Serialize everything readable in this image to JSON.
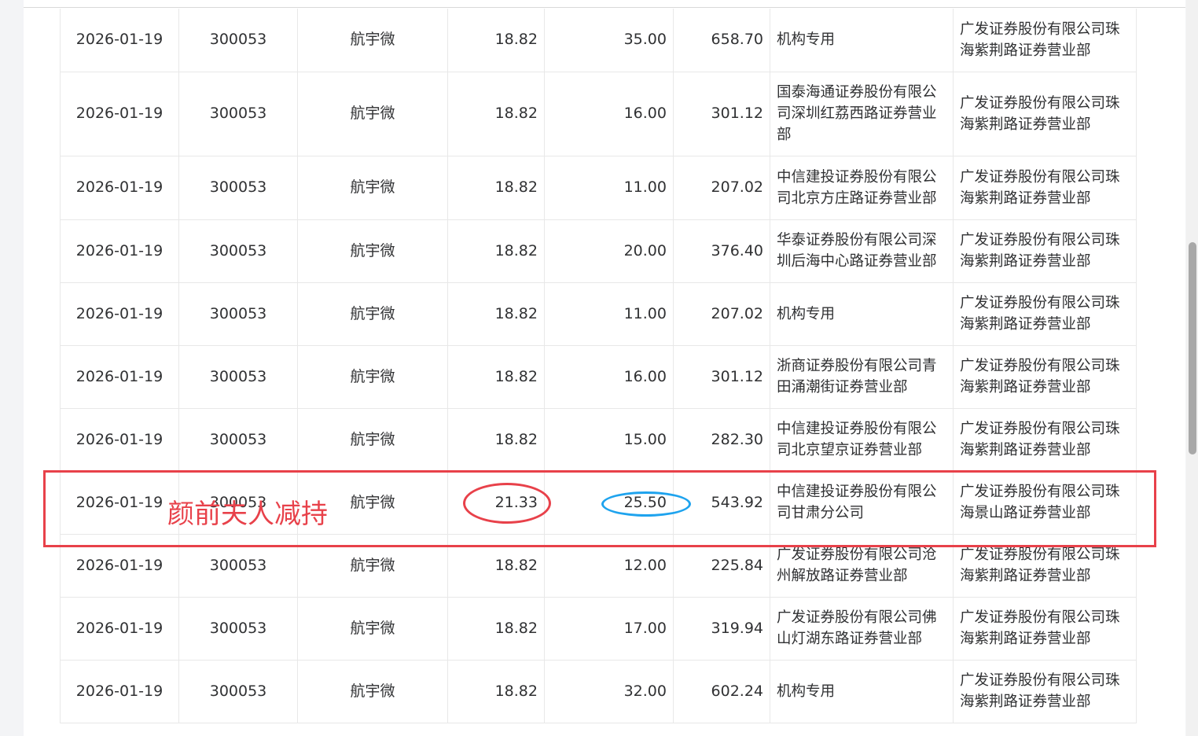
{
  "table": {
    "rows": [
      {
        "date": "2026-01-19",
        "code": "300053",
        "name": "航宇微",
        "price": "18.82",
        "volume": "35.00",
        "amount": "658.70",
        "buyer": "机构专用",
        "seller": "广发证券股份有限公司珠海紫荆路证券营业部"
      },
      {
        "date": "2026-01-19",
        "code": "300053",
        "name": "航宇微",
        "price": "18.82",
        "volume": "16.00",
        "amount": "301.12",
        "buyer": "国泰海通证券股份有限公司深圳红荔西路证券营业部",
        "seller": "广发证券股份有限公司珠海紫荆路证券营业部"
      },
      {
        "date": "2026-01-19",
        "code": "300053",
        "name": "航宇微",
        "price": "18.82",
        "volume": "11.00",
        "amount": "207.02",
        "buyer": "中信建投证券股份有限公司北京方庄路证券营业部",
        "seller": "广发证券股份有限公司珠海紫荆路证券营业部"
      },
      {
        "date": "2026-01-19",
        "code": "300053",
        "name": "航宇微",
        "price": "18.82",
        "volume": "20.00",
        "amount": "376.40",
        "buyer": "华泰证券股份有限公司深圳后海中心路证券营业部",
        "seller": "广发证券股份有限公司珠海紫荆路证券营业部"
      },
      {
        "date": "2026-01-19",
        "code": "300053",
        "name": "航宇微",
        "price": "18.82",
        "volume": "11.00",
        "amount": "207.02",
        "buyer": "机构专用",
        "seller": "广发证券股份有限公司珠海紫荆路证券营业部"
      },
      {
        "date": "2026-01-19",
        "code": "300053",
        "name": "航宇微",
        "price": "18.82",
        "volume": "16.00",
        "amount": "301.12",
        "buyer": "浙商证券股份有限公司青田涌潮街证券营业部",
        "seller": "广发证券股份有限公司珠海紫荆路证券营业部"
      },
      {
        "date": "2026-01-19",
        "code": "300053",
        "name": "航宇微",
        "price": "18.82",
        "volume": "15.00",
        "amount": "282.30",
        "buyer": "中信建投证券股份有限公司北京望京证券营业部",
        "seller": "广发证券股份有限公司珠海紫荆路证券营业部"
      },
      {
        "date": "2026-01-19",
        "code": "300053",
        "name": "航宇微",
        "price": "21.33",
        "volume": "25.50",
        "amount": "543.92",
        "buyer": "中信建投证券股份有限公司甘肃分公司",
        "seller": "广发证券股份有限公司珠海景山路证券营业部"
      },
      {
        "date": "2026-01-19",
        "code": "300053",
        "name": "航宇微",
        "price": "18.82",
        "volume": "12.00",
        "amount": "225.84",
        "buyer": "广发证券股份有限公司沧州解放路证券营业部",
        "seller": "广发证券股份有限公司珠海紫荆路证券营业部"
      },
      {
        "date": "2026-01-19",
        "code": "300053",
        "name": "航宇微",
        "price": "18.82",
        "volume": "17.00",
        "amount": "319.94",
        "buyer": "广发证券股份有限公司佛山灯湖东路证券营业部",
        "seller": "广发证券股份有限公司珠海紫荆路证券营业部"
      },
      {
        "date": "2026-01-19",
        "code": "300053",
        "name": "航宇微",
        "price": "18.82",
        "volume": "32.00",
        "amount": "602.24",
        "buyer": "机构专用",
        "seller": "广发证券股份有限公司珠海紫荆路证券营业部"
      }
    ]
  },
  "annotation": {
    "text": "颜前夫人减持",
    "box_color": "#e8414a",
    "price_circle_color": "#e8414a",
    "volume_circle_color": "#1ea3ee"
  }
}
